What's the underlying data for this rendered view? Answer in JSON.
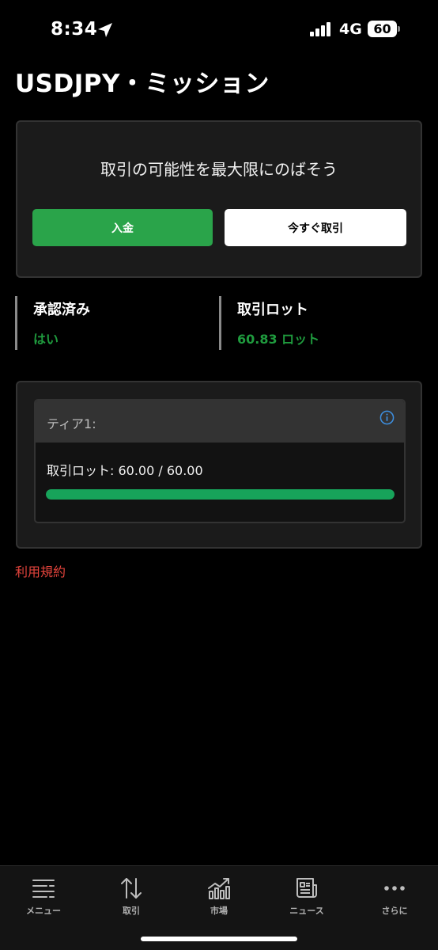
{
  "status_bar": {
    "time": "8:34",
    "network": "4G",
    "battery": "60",
    "icons": [
      "location-arrow-icon",
      "signal-bars-icon",
      "battery-icon"
    ]
  },
  "page": {
    "title": "USDJPY・ミッション"
  },
  "promo": {
    "text": "取引の可能性を最大限にのばそう",
    "deposit_label": "入金",
    "trade_label": "今すぐ取引",
    "colors": {
      "deposit": "#2aa44a",
      "trade": "#ffffff"
    }
  },
  "stats": {
    "approved_label": "承認済み",
    "approved_value": "はい",
    "lots_label": "取引ロット",
    "lots_value": "60.83 ロット",
    "value_color": "#1f9b3e"
  },
  "tier": {
    "label": "ティア1:",
    "lots_text": "取引ロット: 60.00 / 60.00",
    "progress_fraction": 1.0,
    "progress_color": "#17a35a",
    "info_icon": "info-icon"
  },
  "terms_link": "利用規約",
  "tabbar": [
    {
      "label": "メニュー",
      "icon": "menu-icon"
    },
    {
      "label": "取引",
      "icon": "trade-arrows-icon"
    },
    {
      "label": "市場",
      "icon": "market-chart-icon"
    },
    {
      "label": "ニュース",
      "icon": "news-icon"
    },
    {
      "label": "さらに",
      "icon": "more-dots-icon"
    }
  ]
}
